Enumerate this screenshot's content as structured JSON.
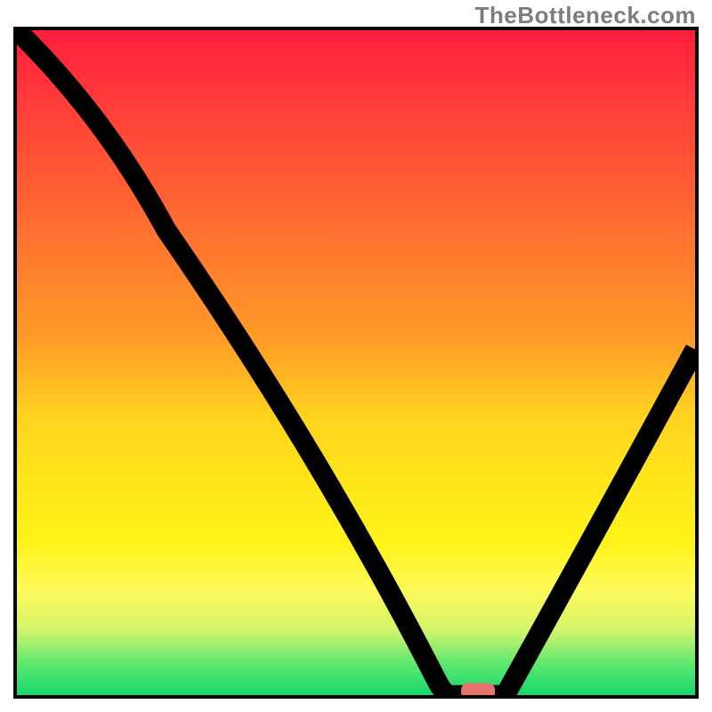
{
  "watermark": "TheBottleneck.com",
  "chart_data": {
    "type": "line",
    "title": "",
    "xlabel": "",
    "ylabel": "",
    "xlim": [
      0,
      100
    ],
    "ylim": [
      0,
      100
    ],
    "grid": false,
    "legend": false,
    "series": [
      {
        "name": "bottleneck-curve",
        "points": [
          {
            "x": 0,
            "y": 100
          },
          {
            "x": 22,
            "y": 70
          },
          {
            "x": 62,
            "y": 2
          },
          {
            "x": 64,
            "y": 0
          },
          {
            "x": 72,
            "y": 0
          },
          {
            "x": 100,
            "y": 52
          }
        ]
      }
    ],
    "marker": {
      "x": 68,
      "y": 0,
      "w": 5,
      "h": 2.4,
      "color": "#e6736e"
    },
    "gradient_stops": [
      {
        "pos": 0,
        "color": "#ff1e3c"
      },
      {
        "pos": 10,
        "color": "#ff3a3a"
      },
      {
        "pos": 22,
        "color": "#ff5a34"
      },
      {
        "pos": 34,
        "color": "#ff7b2e"
      },
      {
        "pos": 46,
        "color": "#ff9a28"
      },
      {
        "pos": 58,
        "color": "#ffd21f"
      },
      {
        "pos": 68,
        "color": "#ffe61a"
      },
      {
        "pos": 77,
        "color": "#fff318"
      },
      {
        "pos": 84,
        "color": "#fffb5a"
      },
      {
        "pos": 90,
        "color": "#d7f56b"
      },
      {
        "pos": 95,
        "color": "#63e86f"
      },
      {
        "pos": 100,
        "color": "#16d86c"
      }
    ]
  }
}
